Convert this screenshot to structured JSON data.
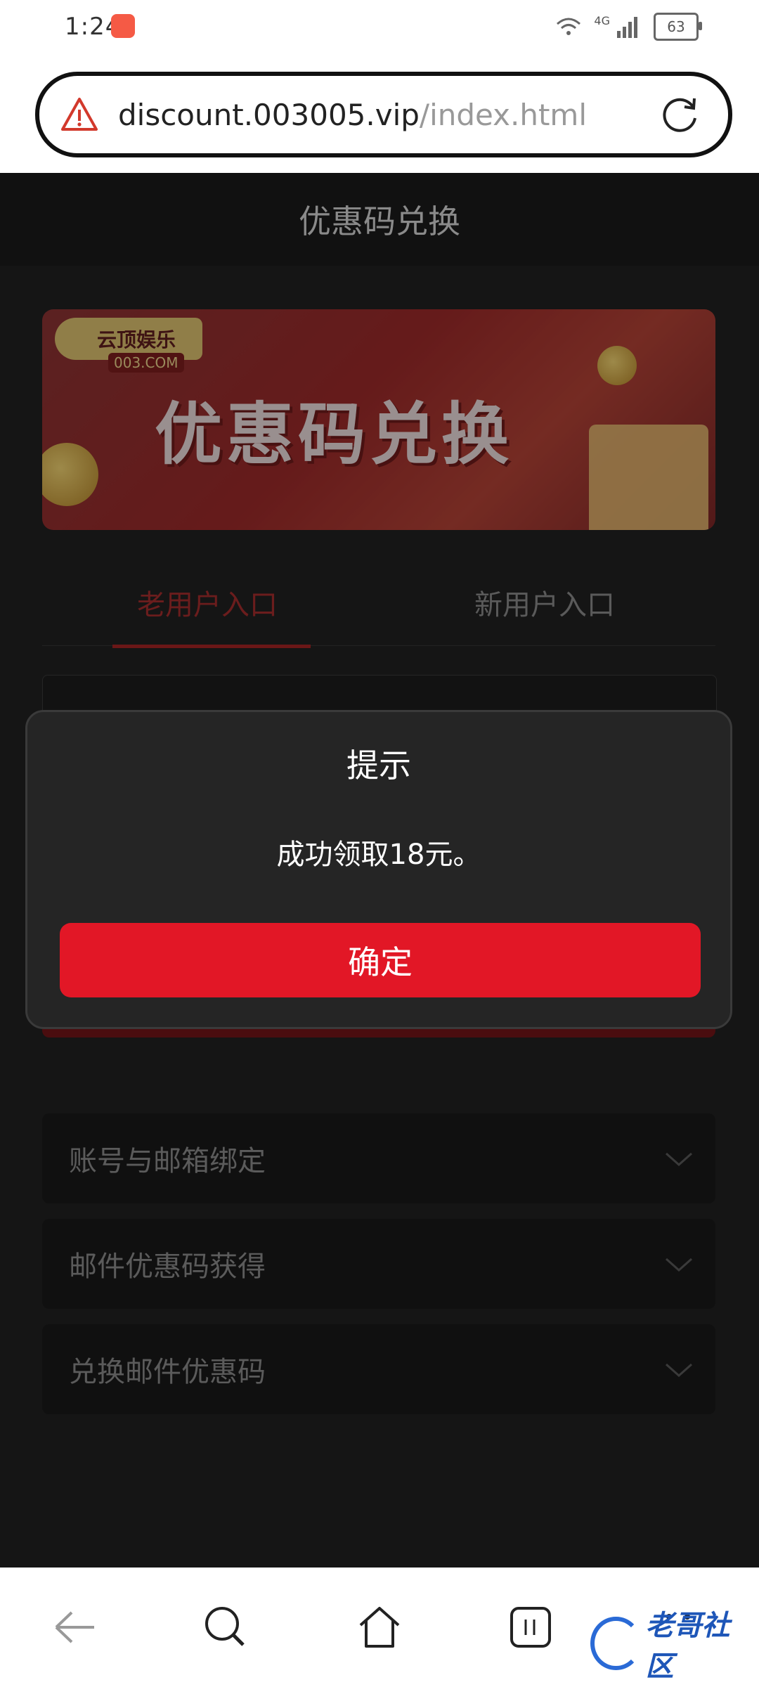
{
  "status_bar": {
    "time": "1:24",
    "network": "4G",
    "battery": "63"
  },
  "url_bar": {
    "domain": "discount.003005.vip",
    "path": "/index.html"
  },
  "header": {
    "title": "优惠码兑换"
  },
  "banner": {
    "logo_text": "云顶娱乐",
    "logo_sub": "003.COM",
    "title": "优惠码兑换"
  },
  "tabs": [
    {
      "label": "老用户入口",
      "active": true
    },
    {
      "label": "新用户入口",
      "active": false
    }
  ],
  "accordion": [
    {
      "label": "账号与邮箱绑定"
    },
    {
      "label": "邮件优惠码获得"
    },
    {
      "label": "兑换邮件优惠码"
    }
  ],
  "dialog": {
    "title": "提示",
    "message": "成功领取18元。",
    "confirm_label": "确定"
  },
  "watermark": {
    "text": "老哥社区"
  },
  "colors": {
    "accent": "#e21726",
    "dialog_bg": "#252525",
    "page_bg": "#151515"
  }
}
